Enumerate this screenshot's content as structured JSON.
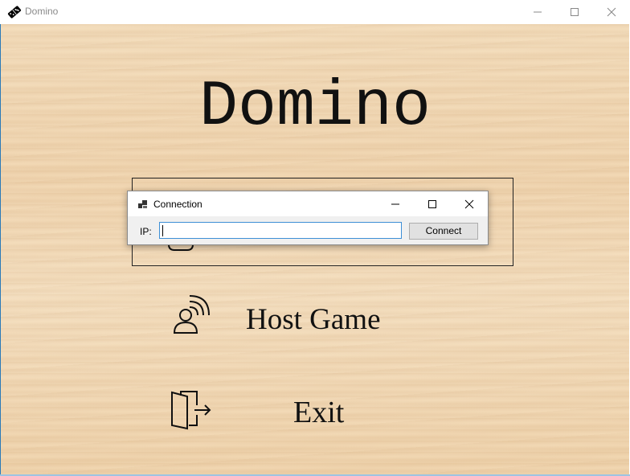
{
  "window": {
    "title": "Domino",
    "icon": "domino-icon",
    "controls": [
      "minimize",
      "maximize",
      "close"
    ]
  },
  "menu": {
    "title": "Domino",
    "items": [
      {
        "id": "join",
        "label": "",
        "icon": "gamepad-icon"
      },
      {
        "id": "host",
        "label": "Host Game",
        "icon": "broadcast-user-icon"
      },
      {
        "id": "exit",
        "label": "Exit",
        "icon": "door-exit-icon"
      }
    ]
  },
  "dialog": {
    "title": "Connection",
    "icon": "dialog-app-icon",
    "ip_label": "IP:",
    "ip_value": "",
    "connect_label": "Connect"
  },
  "colors": {
    "accent": "#3d8fd6",
    "frame": "#2a7ab8",
    "wood": "#f0d8b6"
  }
}
